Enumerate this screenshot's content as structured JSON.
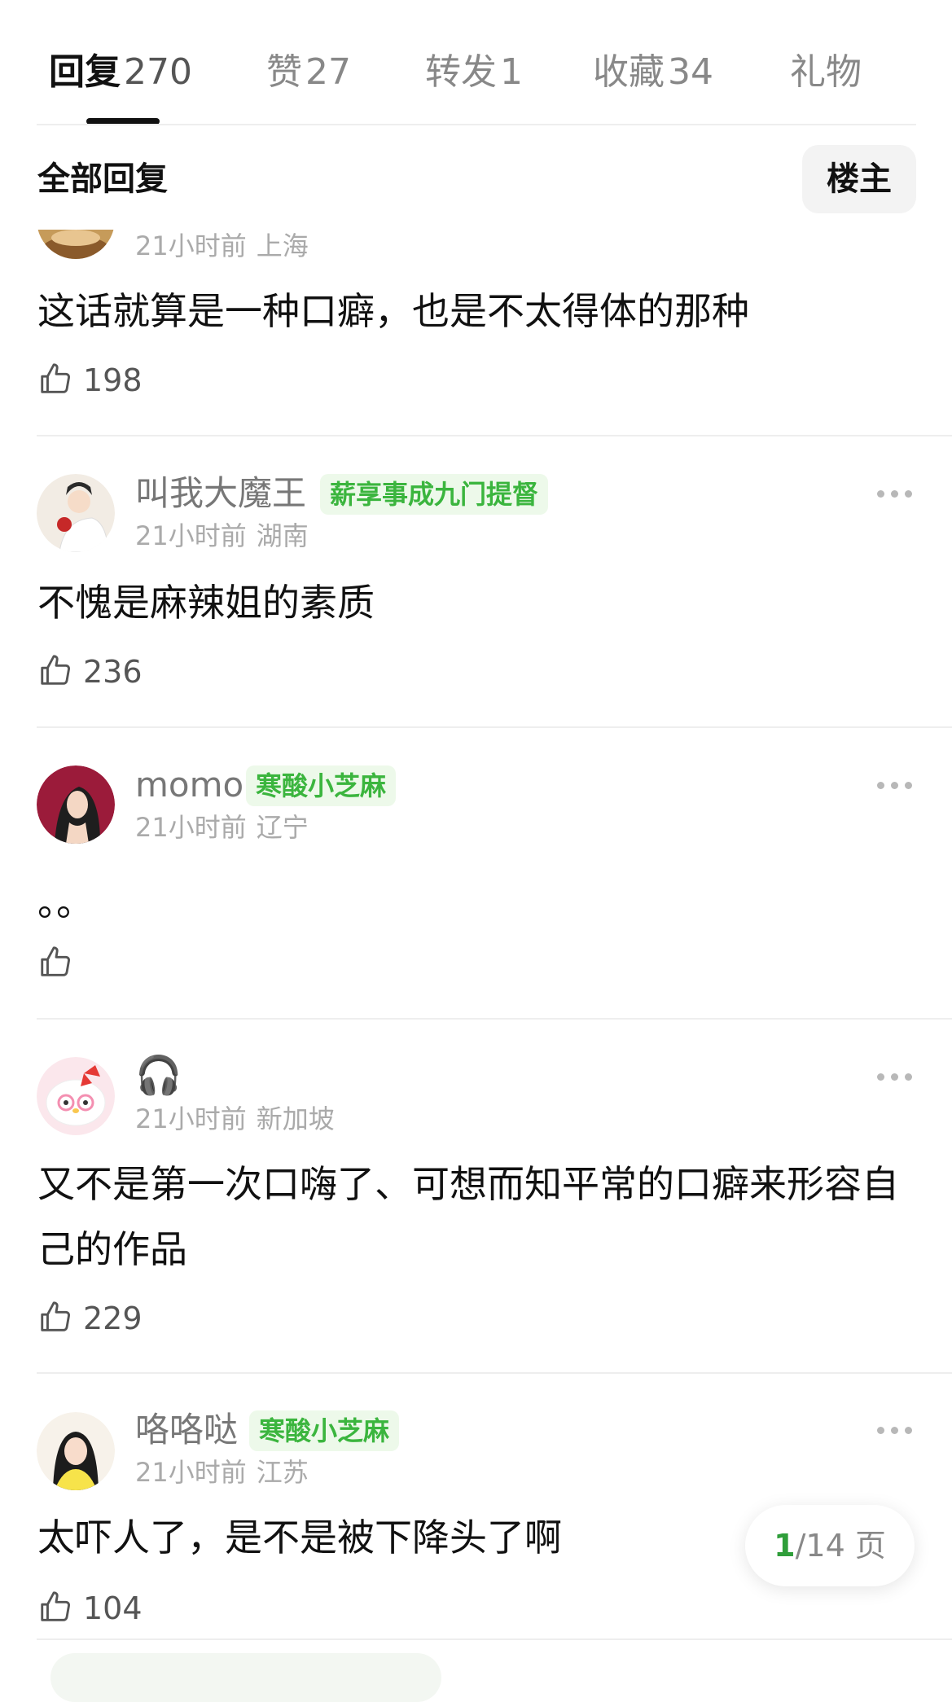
{
  "tabs": [
    {
      "label": "回复",
      "count": "270"
    },
    {
      "label": "赞",
      "count": "27"
    },
    {
      "label": "转发",
      "count": "1"
    },
    {
      "label": "收藏",
      "count": "34"
    },
    {
      "label": "礼物",
      "count": ""
    }
  ],
  "filter": {
    "title": "全部回复",
    "op_button": "楼主"
  },
  "comments": [
    {
      "username": "",
      "badge": "",
      "time": "21小时前",
      "location": "上海",
      "content": "这话就算是一种口癖，也是不太得体的那种",
      "likes": "198"
    },
    {
      "username": "叫我大魔王",
      "badge": "薪享事成九门提督",
      "time": "21小时前",
      "location": "湖南",
      "content": "不愧是麻辣姐的素质",
      "likes": "236"
    },
    {
      "username": "momo",
      "badge": "寒酸小芝麻",
      "time": "21小时前",
      "location": "辽宁",
      "content": "。。",
      "likes": ""
    },
    {
      "username": "🎧",
      "badge": "",
      "time": "21小时前",
      "location": "新加坡",
      "content": "又不是第一次口嗨了、可想而知平常的口癖来形容自己的作品",
      "likes": "229"
    },
    {
      "username": "咯咯哒",
      "badge": "寒酸小芝麻",
      "time": "21小时前",
      "location": "江苏",
      "content": "太吓人了，是不是被下降头了啊",
      "likes": "104"
    }
  ],
  "pagination": {
    "current": "1",
    "total": "/14 页"
  },
  "colors": {
    "accent_green": "#3bb53e",
    "badge_bg": "#edf9ea",
    "text_primary": "#111111",
    "text_secondary": "#777777",
    "text_meta": "#aaaaaa"
  }
}
